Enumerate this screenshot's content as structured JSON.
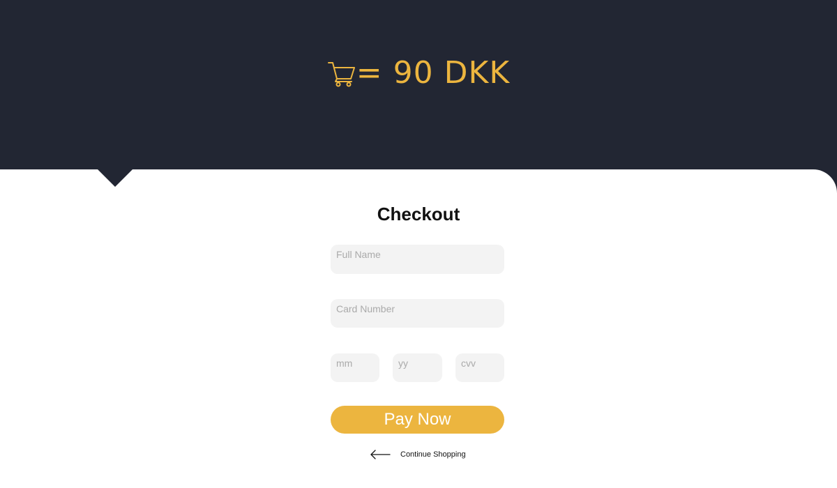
{
  "header": {
    "total_label": "= 90 DKK",
    "icon": "cart-icon",
    "accent_color": "#ecb53f",
    "background_color": "#222633"
  },
  "checkout": {
    "title": "Checkout",
    "fields": {
      "full_name": {
        "placeholder": "Full Name",
        "value": ""
      },
      "card_number": {
        "placeholder": "Card Number",
        "value": ""
      },
      "mm": {
        "placeholder": "mm",
        "value": ""
      },
      "yy": {
        "placeholder": "yy",
        "value": ""
      },
      "cvv": {
        "placeholder": "cvv",
        "value": ""
      }
    },
    "pay_button_label": "Pay Now",
    "continue_label": "Continue Shopping",
    "continue_icon": "arrow-left-icon"
  }
}
